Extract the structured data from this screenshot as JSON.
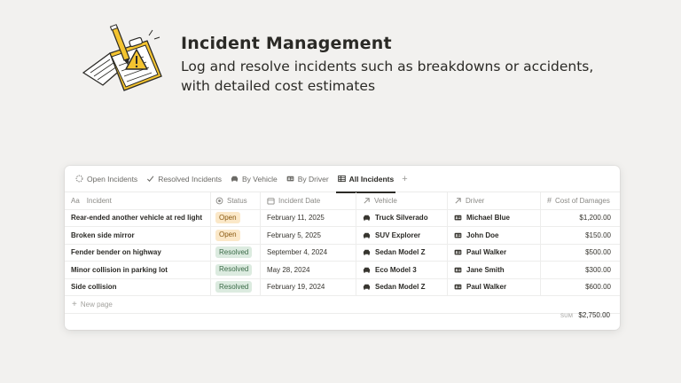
{
  "hero": {
    "title": "Incident Management",
    "subtitle": "Log and resolve incidents such as breakdowns or accidents, with detailed cost estimates"
  },
  "tabs": [
    {
      "label": "Open Incidents",
      "icon": "circle-dashed-icon",
      "active": false
    },
    {
      "label": "Resolved Incidents",
      "icon": "checkmark-icon",
      "active": false
    },
    {
      "label": "By Vehicle",
      "icon": "car-icon",
      "active": false
    },
    {
      "label": "By Driver",
      "icon": "id-card-icon",
      "active": false
    },
    {
      "label": "All Incidents",
      "icon": "table-icon",
      "active": true
    }
  ],
  "add_tab": "+",
  "columns": {
    "incident": "Incident",
    "incident_prefix": "Aa",
    "status": "Status",
    "date": "Incident Date",
    "vehicle": "Vehicle",
    "driver": "Driver",
    "cost": "Cost of Damages"
  },
  "rows": [
    {
      "incident": "Rear-ended another vehicle at red light",
      "status": "Open",
      "date": "February 11, 2025",
      "vehicle": "Truck Silverado",
      "driver": "Michael Blue",
      "cost": "$1,200.00"
    },
    {
      "incident": "Broken side mirror",
      "status": "Open",
      "date": "February 5, 2025",
      "vehicle": "SUV Explorer",
      "driver": "John Doe",
      "cost": "$150.00"
    },
    {
      "incident": "Fender bender on highway",
      "status": "Resolved",
      "date": "September 4, 2024",
      "vehicle": "Sedan Model Z",
      "driver": "Paul Walker",
      "cost": "$500.00"
    },
    {
      "incident": "Minor collision in parking lot",
      "status": "Resolved",
      "date": "May 28, 2024",
      "vehicle": "Eco Model 3",
      "driver": "Jane Smith",
      "cost": "$300.00"
    },
    {
      "incident": "Side collision",
      "status": "Resolved",
      "date": "February 19, 2024",
      "vehicle": "Sedan Model Z",
      "driver": "Paul Walker",
      "cost": "$600.00"
    }
  ],
  "new_page": "New page",
  "new_page_icon": "+",
  "summary": {
    "label": "SUM",
    "value": "$2,750.00"
  },
  "colors": {
    "open_badge": "#fbe8c8",
    "resolved_badge": "#dcebe0",
    "accent": "#f4c430"
  }
}
